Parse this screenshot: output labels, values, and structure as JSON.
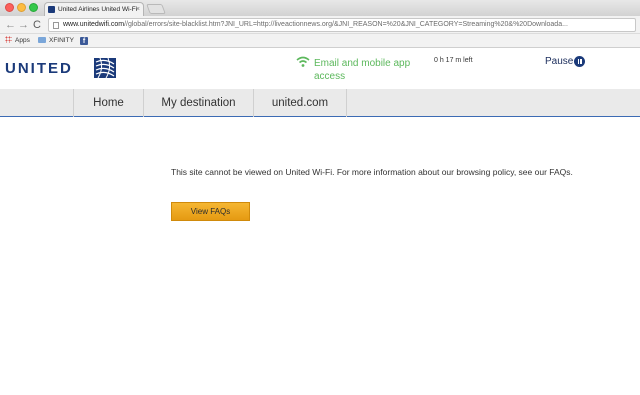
{
  "browser": {
    "tab_title": "United Airlines United Wi-Fi",
    "tab_close": "×",
    "nav_back": "←",
    "nav_forward": "→",
    "nav_reload": "C",
    "url_host": "www.unitedwifi.com",
    "url_rest": "//global/errors/site-blacklist.htm?JNI_URL=http://liveactionnews.org/&JNI_REASON=%20&JNI_CATEGORY=Streaming%20&%20Downloada...",
    "bookmarks": {
      "apps_label": "Apps",
      "xfinity_label": "XFINITY",
      "facebook_label": "f"
    }
  },
  "header": {
    "logo_text": "UNITED",
    "wifi_status": "Email and mobile app access",
    "time_left": "0 h 17 m left",
    "pause_label": "Pause",
    "colors": {
      "brand": "#1b3a7a",
      "wifi": "#5cb85c"
    }
  },
  "nav": {
    "items": [
      {
        "label": "Home"
      },
      {
        "label": "My destination"
      },
      {
        "label": "united.com"
      }
    ]
  },
  "main": {
    "message": "This site cannot be viewed on United Wi-Fi. For more information about our browsing policy, see our FAQs.",
    "faq_button_label": "View FAQs",
    "colors": {
      "button": "#f0a820"
    }
  }
}
